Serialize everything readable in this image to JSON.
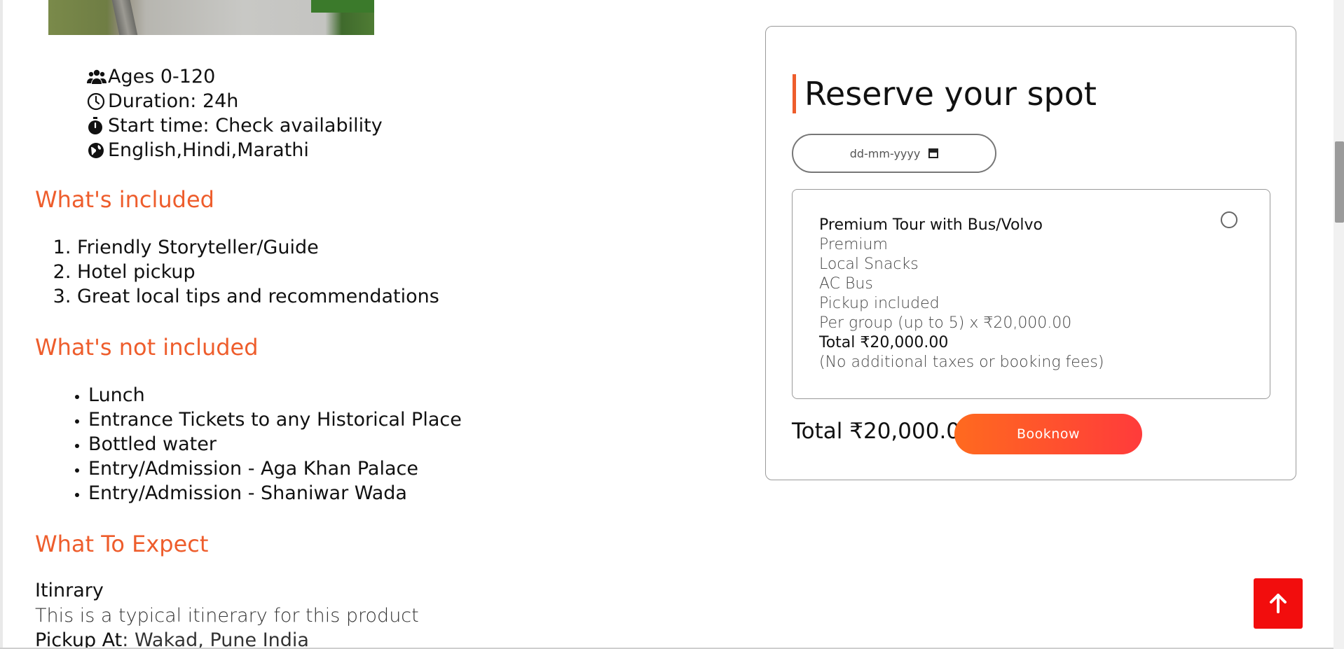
{
  "facts": {
    "ages": "Ages 0-120",
    "duration": "Duration: 24h",
    "start_time": "Start time: Check availability",
    "languages": "English,Hindi,Marathi"
  },
  "included": {
    "title": "What's included",
    "items": [
      "Friendly Storyteller/Guide",
      "Hotel pickup",
      "Great local tips and recommendations"
    ]
  },
  "not_included": {
    "title": "What's not included",
    "items": [
      "Lunch",
      "Entrance Tickets to any Historical Place",
      "Bottled water",
      "Entry/Admission - Aga Khan Palace",
      "Entry/Admission - Shaniwar Wada"
    ]
  },
  "expect": {
    "title": "What To Expect",
    "itinerary_heading": "Itinrary",
    "itinerary_text": "This is a typical itinerary for this product",
    "pickup_label": "Pickup At",
    "pickup_value": ": Wakad, Pune India"
  },
  "booking": {
    "title": "Reserve your spot",
    "date_placeholder": "dd-mm-yyyy",
    "option": {
      "name": "Premium Tour with Bus/Volvo",
      "tier": "Premium",
      "feature_1": "Local Snacks",
      "feature_2": "AC Bus",
      "feature_3": "Pickup included",
      "pricing": "Per group (up to 5) x ₹20,000.00",
      "total": "Total ₹20,000.00",
      "note": "(No additional taxes or booking fees)",
      "selected": false
    },
    "total": "Total ₹20,000.00",
    "book_label": "Booknow"
  },
  "colors": {
    "accent": "#ee5d2c",
    "button_start": "#ff6a1f",
    "button_end": "#ff3b3b",
    "back_to_top": "#f20d0d"
  },
  "icons": [
    "users-icon",
    "clock-icon",
    "stopwatch-icon",
    "globe-icon",
    "calendar-icon",
    "arrow-up-icon"
  ]
}
